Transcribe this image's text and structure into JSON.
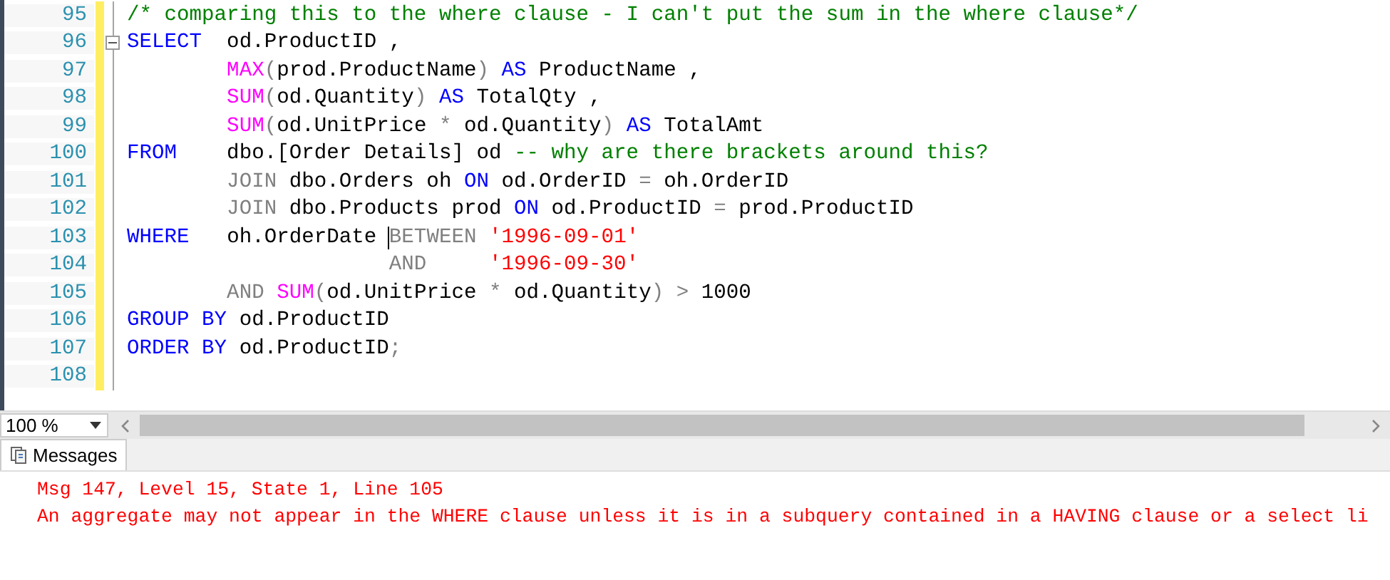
{
  "editor": {
    "lines": [
      {
        "number": "95",
        "fold": false,
        "tokens": [
          {
            "kind": "comment",
            "text": "/* comparing this to the where clause - I can't put the sum in the where clause*/"
          }
        ]
      },
      {
        "number": "96",
        "fold": true,
        "tokens": [
          {
            "kind": "keyword",
            "text": "SELECT"
          },
          {
            "kind": "plain",
            "text": "  od.ProductID ,"
          }
        ]
      },
      {
        "number": "97",
        "fold": false,
        "tokens": [
          {
            "kind": "function",
            "text": "        MAX"
          },
          {
            "kind": "operator",
            "text": "("
          },
          {
            "kind": "plain",
            "text": "prod.ProductName"
          },
          {
            "kind": "operator",
            "text": ")"
          },
          {
            "kind": "keyword",
            "text": " AS"
          },
          {
            "kind": "plain",
            "text": " ProductName ,"
          }
        ]
      },
      {
        "number": "98",
        "fold": false,
        "tokens": [
          {
            "kind": "function",
            "text": "        SUM"
          },
          {
            "kind": "operator",
            "text": "("
          },
          {
            "kind": "plain",
            "text": "od.Quantity"
          },
          {
            "kind": "operator",
            "text": ")"
          },
          {
            "kind": "keyword",
            "text": " AS"
          },
          {
            "kind": "plain",
            "text": " TotalQty ,"
          }
        ]
      },
      {
        "number": "99",
        "fold": false,
        "tokens": [
          {
            "kind": "function",
            "text": "        SUM"
          },
          {
            "kind": "operator",
            "text": "("
          },
          {
            "kind": "plain",
            "text": "od.UnitPrice"
          },
          {
            "kind": "operator",
            "text": " *"
          },
          {
            "kind": "plain",
            "text": " od.Quantity"
          },
          {
            "kind": "operator",
            "text": ")"
          },
          {
            "kind": "keyword",
            "text": " AS"
          },
          {
            "kind": "plain",
            "text": " TotalAmt"
          }
        ]
      },
      {
        "number": "100",
        "fold": false,
        "tokens": [
          {
            "kind": "keyword",
            "text": "FROM"
          },
          {
            "kind": "plain",
            "text": "    dbo.[Order Details] od"
          },
          {
            "kind": "comment",
            "text": " -- why are there brackets around this?"
          }
        ]
      },
      {
        "number": "101",
        "fold": false,
        "tokens": [
          {
            "kind": "operator",
            "text": "        JOIN"
          },
          {
            "kind": "plain",
            "text": " dbo.Orders oh"
          },
          {
            "kind": "keyword",
            "text": " ON"
          },
          {
            "kind": "plain",
            "text": " od.OrderID"
          },
          {
            "kind": "operator",
            "text": " ="
          },
          {
            "kind": "plain",
            "text": " oh.OrderID"
          }
        ]
      },
      {
        "number": "102",
        "fold": false,
        "tokens": [
          {
            "kind": "operator",
            "text": "        JOIN"
          },
          {
            "kind": "plain",
            "text": " dbo.Products prod"
          },
          {
            "kind": "keyword",
            "text": " ON"
          },
          {
            "kind": "plain",
            "text": " od.ProductID"
          },
          {
            "kind": "operator",
            "text": " ="
          },
          {
            "kind": "plain",
            "text": " prod.ProductID"
          }
        ]
      },
      {
        "number": "103",
        "fold": false,
        "tokens": [
          {
            "kind": "keyword",
            "text": "WHERE"
          },
          {
            "kind": "plain",
            "text": "   oh.OrderDate "
          },
          {
            "kind": "operator",
            "text": "BETWEEN",
            "caret": true
          },
          {
            "kind": "string",
            "text": " '1996-09-01'"
          }
        ]
      },
      {
        "number": "104",
        "fold": false,
        "tokens": [
          {
            "kind": "operator",
            "text": "                     AND"
          },
          {
            "kind": "string",
            "text": "     '1996-09-30'"
          }
        ]
      },
      {
        "number": "105",
        "fold": false,
        "tokens": [
          {
            "kind": "operator",
            "text": "        AND"
          },
          {
            "kind": "function",
            "text": " SUM"
          },
          {
            "kind": "operator",
            "text": "("
          },
          {
            "kind": "plain",
            "text": "od.UnitPrice"
          },
          {
            "kind": "operator",
            "text": " *"
          },
          {
            "kind": "plain",
            "text": " od.Quantity"
          },
          {
            "kind": "operator",
            "text": ") >"
          },
          {
            "kind": "plain",
            "text": " 1000"
          }
        ]
      },
      {
        "number": "106",
        "fold": false,
        "tokens": [
          {
            "kind": "keyword",
            "text": "GROUP BY"
          },
          {
            "kind": "plain",
            "text": " od.ProductID"
          }
        ]
      },
      {
        "number": "107",
        "fold": false,
        "tokens": [
          {
            "kind": "keyword",
            "text": "ORDER BY"
          },
          {
            "kind": "plain",
            "text": " od.ProductID"
          },
          {
            "kind": "operator",
            "text": ";"
          }
        ]
      },
      {
        "number": "108",
        "fold": false
      }
    ]
  },
  "zoom": {
    "value": "100 %"
  },
  "results": {
    "tab": {
      "label": "Messages",
      "selected": true
    },
    "messages": [
      "Msg 147, Level 15, State 1, Line 105",
      "An aggregate may not appear in the WHERE clause unless it is in a subquery contained in a HAVING clause or a select li"
    ]
  }
}
